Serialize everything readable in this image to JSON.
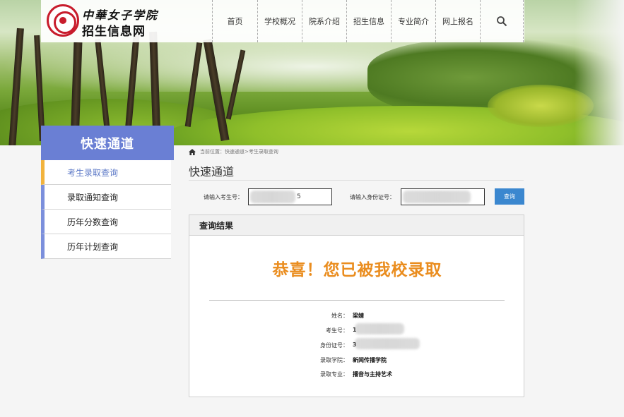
{
  "header": {
    "brand_line1": "中華女子学院",
    "brand_line2": "招生信息网",
    "nav": [
      {
        "label": "首页"
      },
      {
        "label": "学校概况"
      },
      {
        "label": "院系介绍"
      },
      {
        "label": "招生信息"
      },
      {
        "label": "专业简介"
      },
      {
        "label": "网上报名"
      }
    ],
    "search_icon": "search-icon"
  },
  "sidebar": {
    "title": "快速通道",
    "items": [
      {
        "label": "考生录取查询",
        "active": true
      },
      {
        "label": "录取通知查询",
        "active": false
      },
      {
        "label": "历年分数查询",
        "active": false
      },
      {
        "label": "历年计划查询",
        "active": false
      }
    ]
  },
  "breadcrumb": {
    "icon": "home-icon",
    "text": "当前位置：快速通道>考生录取查询"
  },
  "main": {
    "title": "快速通道",
    "form": {
      "exam_label": "请输入考生号：",
      "exam_value": "5",
      "id_label": "请输入身份证号：",
      "id_value": "",
      "query_label": "查询"
    },
    "result": {
      "header": "查询结果",
      "congrats": "恭喜！您已被我校录取",
      "rows": [
        {
          "label": "姓名：",
          "value": "梁婧"
        },
        {
          "label": "考生号：",
          "value": "1"
        },
        {
          "label": "身份证号：",
          "value": "3"
        },
        {
          "label": "录取学院：",
          "value": "新闻传播学院"
        },
        {
          "label": "录取专业：",
          "value": "播音与主持艺术"
        }
      ]
    }
  },
  "colors": {
    "accent": "#6a7fd4",
    "sidebar_active_bar": "#f2b33d",
    "congrats": "#ea8d1f",
    "button": "#3b87cf",
    "logo": "#c81c2c"
  }
}
